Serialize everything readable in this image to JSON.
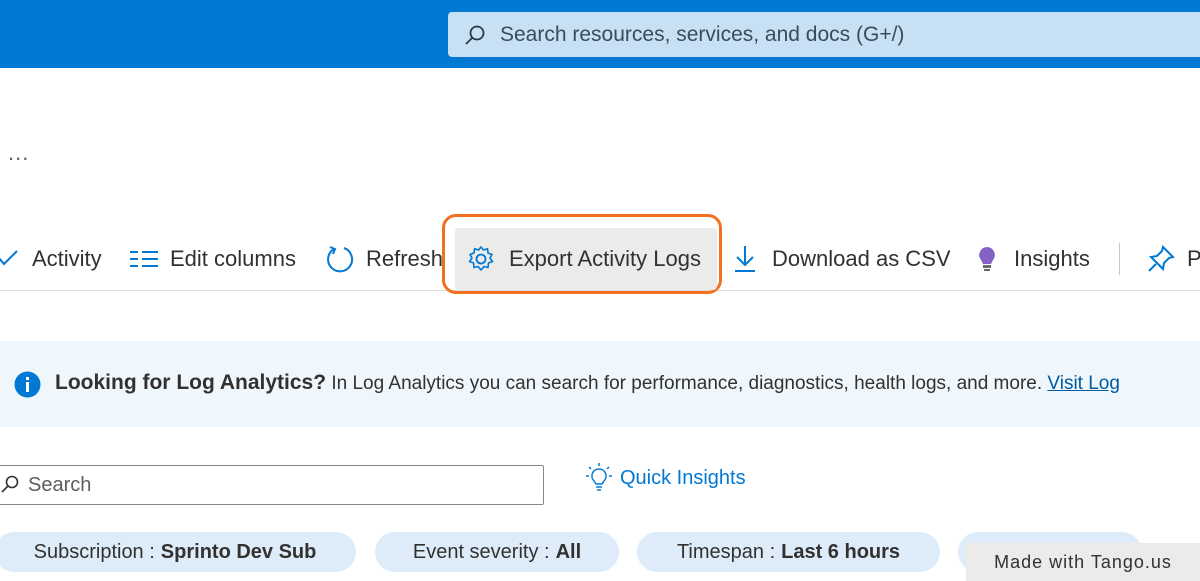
{
  "header": {
    "search_placeholder": "Search resources, services, and docs (G+/)"
  },
  "breadcrumb": {
    "more": "..."
  },
  "toolbar": {
    "activity": "Activity",
    "edit_columns": "Edit columns",
    "refresh": "Refresh",
    "export": "Export Activity Logs",
    "download_csv": "Download as CSV",
    "insights": "Insights",
    "pin": "P"
  },
  "banner": {
    "title": "Looking for Log Analytics?",
    "text": " In Log Analytics you can search for performance, diagnostics, health logs, and more. ",
    "link": "Visit Log"
  },
  "filters": {
    "search_placeholder": "Search",
    "quick_insights": "Quick Insights",
    "pills": [
      {
        "key": "Subscription :",
        "value": "Sprinto Dev Sub"
      },
      {
        "key": "Event severity :",
        "value": "All"
      },
      {
        "key": "Timespan :",
        "value": "Last 6 hours"
      }
    ]
  },
  "watermark": "Made with Tango.us",
  "colors": {
    "header": "#0078d4",
    "highlight": "#f37021",
    "link": "#0078d4"
  },
  "icons": [
    "search-icon",
    "checkmark-icon",
    "edit-columns-icon",
    "refresh-icon",
    "gear-icon",
    "download-icon",
    "lightbulb-icon",
    "pin-icon",
    "info-icon"
  ]
}
